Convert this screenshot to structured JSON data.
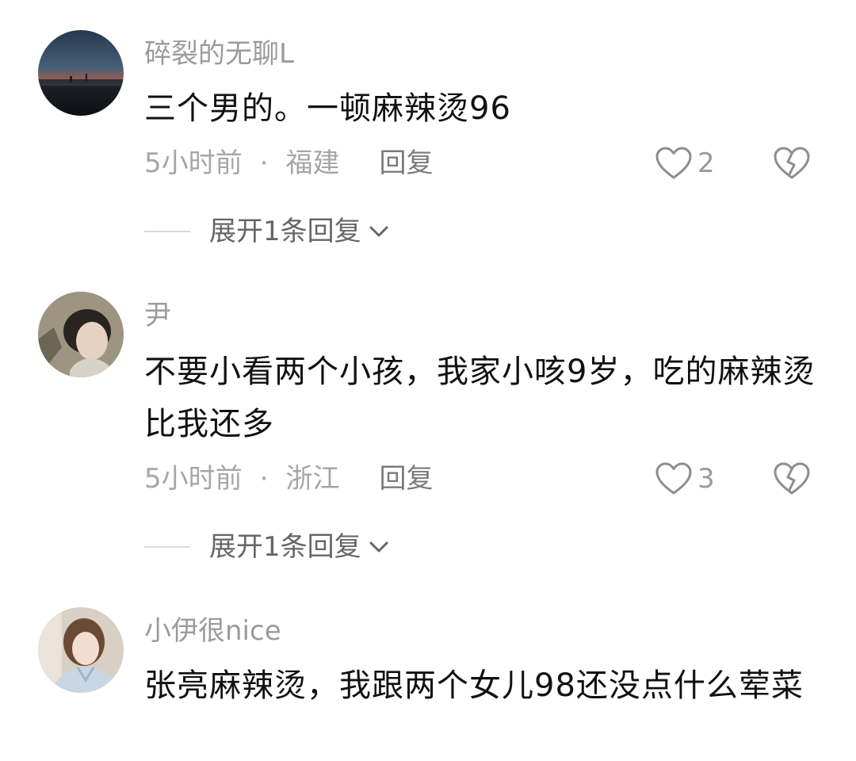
{
  "comments": [
    {
      "username": "碎裂的无聊L",
      "text": "三个男的。一顿麻辣烫96",
      "time": "5小时前",
      "separator": "·",
      "location": "福建",
      "reply_label": "回复",
      "likes": "2",
      "expand_label": "展开1条回复",
      "avatar_icon": "sunset-landscape-avatar"
    },
    {
      "username": "尹",
      "text": "不要小看两个小孩，我家小咳9岁，吃的麻辣烫比我还多",
      "time": "5小时前",
      "separator": "·",
      "location": "浙江",
      "reply_label": "回复",
      "likes": "3",
      "expand_label": "展开1条回复",
      "avatar_icon": "person-avatar"
    },
    {
      "username": "小伊很nice",
      "text": "张亮麻辣烫，我跟两个女儿98还没点什么荤菜",
      "avatar_icon": "woman-avatar"
    }
  ],
  "icons": {
    "like": "heart-outline-icon",
    "dislike": "broken-heart-icon",
    "expand": "chevron-down-icon"
  },
  "colors": {
    "username": "#9b9b9b",
    "text": "#111111",
    "meta": "#a6a6a6",
    "reply": "#7a7a7a",
    "divider": "#d9d9d9"
  }
}
